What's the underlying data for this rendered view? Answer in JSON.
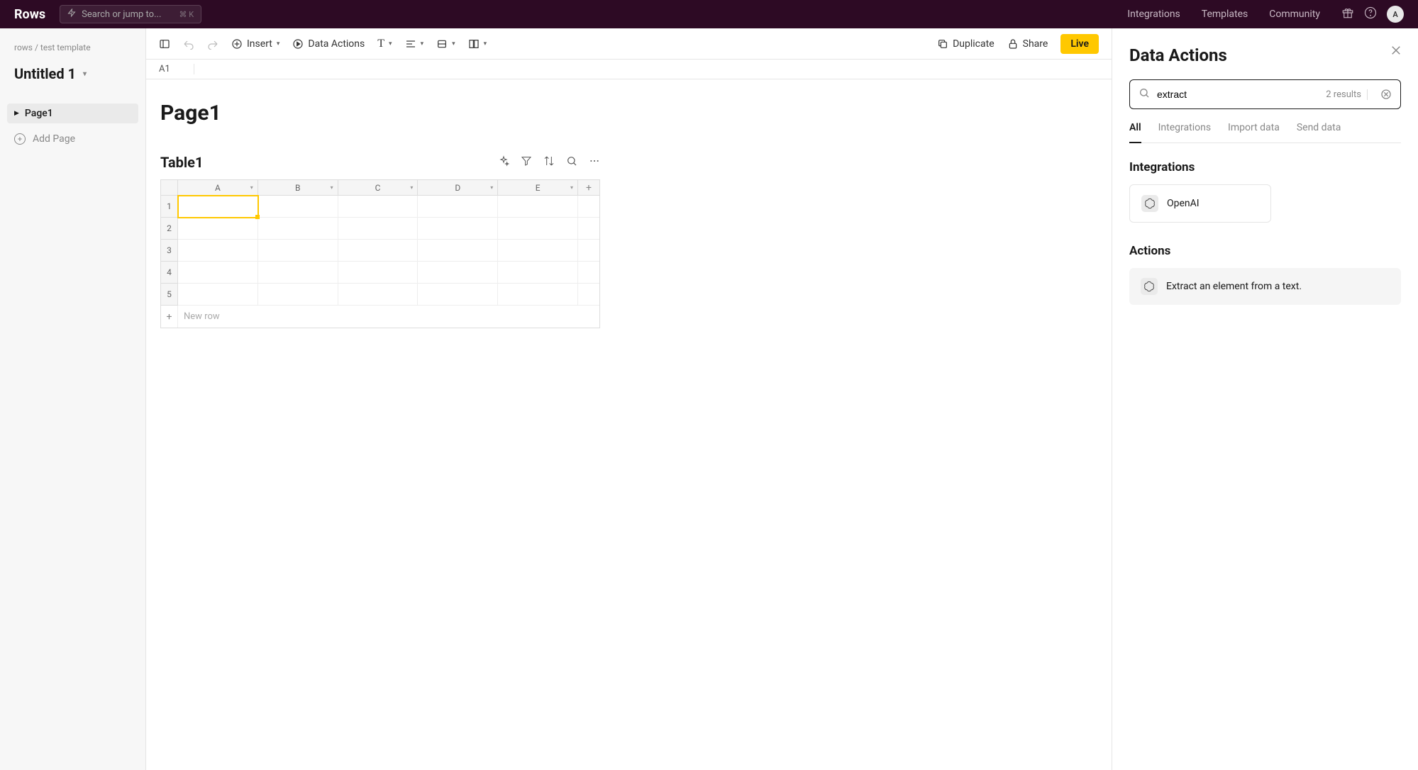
{
  "topnav": {
    "logo": "Rows",
    "search_placeholder": "Search or jump to...",
    "search_shortcut": "⌘ K",
    "links": [
      "Integrations",
      "Templates",
      "Community"
    ],
    "avatar_initial": "A"
  },
  "sidebar": {
    "breadcrumb": "rows / test template",
    "doc_title": "Untitled 1",
    "pages": [
      "Page1"
    ],
    "add_page_label": "Add Page"
  },
  "toolbar": {
    "insert": "Insert",
    "data_actions": "Data Actions",
    "duplicate": "Duplicate",
    "share": "Share",
    "live": "Live"
  },
  "cellref": "A1",
  "content": {
    "page_title": "Page1",
    "table_title": "Table1",
    "columns": [
      "A",
      "B",
      "C",
      "D",
      "E"
    ],
    "rows": [
      1,
      2,
      3,
      4,
      5
    ],
    "new_row_label": "New row",
    "selected_cell": "A1"
  },
  "panel": {
    "title": "Data Actions",
    "search_value": "extract",
    "results_label": "2 results",
    "tabs": [
      "All",
      "Integrations",
      "Import data",
      "Send data"
    ],
    "active_tab": "All",
    "section_integrations": "Integrations",
    "integration_name": "OpenAI",
    "section_actions": "Actions",
    "action_label": "Extract an element from a text."
  }
}
